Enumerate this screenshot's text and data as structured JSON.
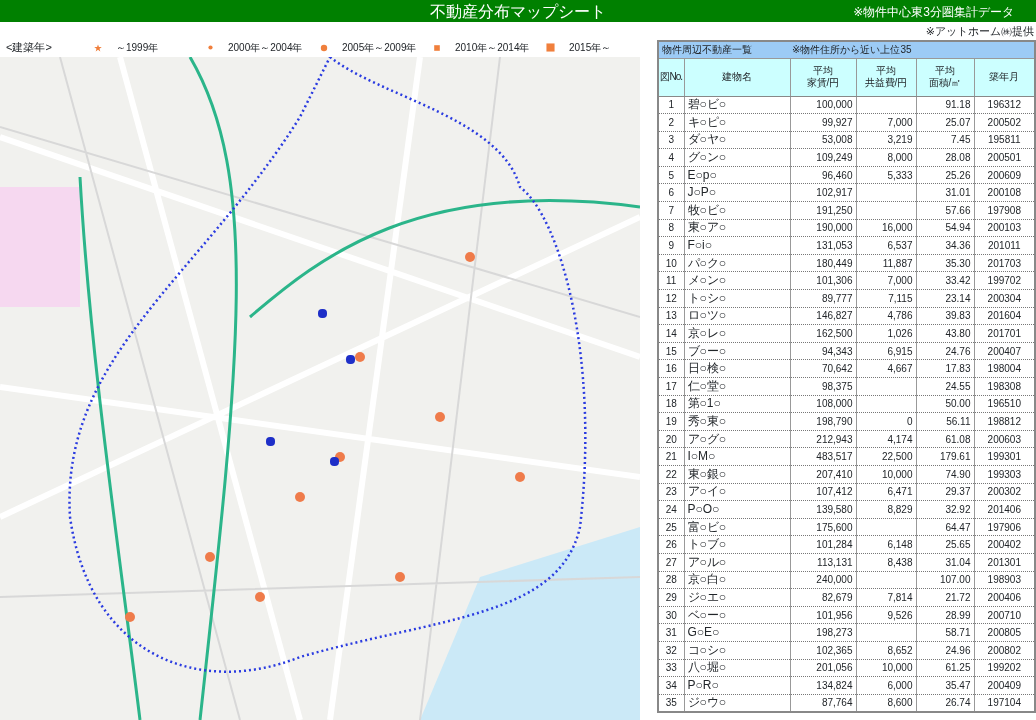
{
  "header": {
    "title": "不動産分布マップシート",
    "note": "※物件中心東3分圏集計データ",
    "credit": "※アットホーム㈱提供"
  },
  "legend": {
    "title": "<建築年>",
    "items": [
      {
        "kind": "star",
        "label": "～1999年"
      },
      {
        "kind": "small-dot",
        "label": "2000年～2004年"
      },
      {
        "kind": "dot",
        "label": "2005年～2009年"
      },
      {
        "kind": "small-square",
        "label": "2010年～2014年"
      },
      {
        "kind": "square",
        "label": "2015年～"
      }
    ]
  },
  "table": {
    "title": "物件周辺不動産一覧",
    "note": "※物件住所から近い上位35",
    "columns": [
      "図No.",
      "建物名",
      "平均家賃/円",
      "平均共益費/円",
      "平均面積/㎡",
      "築年月"
    ],
    "rows": [
      [
        "1",
        "碧○ビ○",
        "100,000",
        null,
        "91.18",
        "196312"
      ],
      [
        "2",
        "キ○ピ○",
        "99,927",
        "7,000",
        "25.07",
        "200502"
      ],
      [
        "3",
        "ダ○ヤ○",
        "53,008",
        "3,219",
        "7.45",
        "195811"
      ],
      [
        "4",
        "グ○ン○",
        "109,249",
        "8,000",
        "28.08",
        "200501"
      ],
      [
        "5",
        "E○p○",
        "96,460",
        "5,333",
        "25.26",
        "200609"
      ],
      [
        "6",
        "J○P○",
        "102,917",
        null,
        "31.01",
        "200108"
      ],
      [
        "7",
        "牧○ビ○",
        "191,250",
        null,
        "57.66",
        "197908"
      ],
      [
        "8",
        "東○ア○",
        "190,000",
        "16,000",
        "54.94",
        "200103"
      ],
      [
        "9",
        "F○i○",
        "131,053",
        "6,537",
        "34.36",
        "201011"
      ],
      [
        "10",
        "パ○ク○",
        "180,449",
        "11,887",
        "35.30",
        "201703"
      ],
      [
        "11",
        "メ○ン○",
        "101,306",
        "7,000",
        "33.42",
        "199702"
      ],
      [
        "12",
        "ト○シ○",
        "89,777",
        "7,115",
        "23.14",
        "200304"
      ],
      [
        "13",
        "ロ○ツ○",
        "146,827",
        "4,786",
        "39.83",
        "201604"
      ],
      [
        "14",
        "京○レ○",
        "162,500",
        "1,026",
        "43.80",
        "201701"
      ],
      [
        "15",
        "ブ○ー○",
        "94,343",
        "6,915",
        "24.76",
        "200407"
      ],
      [
        "16",
        "日○検○",
        "70,642",
        "4,667",
        "17.83",
        "198004"
      ],
      [
        "17",
        "仁○堂○",
        "98,375",
        null,
        "24.55",
        "198308"
      ],
      [
        "18",
        "第○1○",
        "108,000",
        null,
        "50.00",
        "196510"
      ],
      [
        "19",
        "秀○東○",
        "198,790",
        "0",
        "56.11",
        "198812"
      ],
      [
        "20",
        "ア○グ○",
        "212,943",
        "4,174",
        "61.08",
        "200603"
      ],
      [
        "21",
        "I○M○",
        "483,517",
        "22,500",
        "179.61",
        "199301"
      ],
      [
        "22",
        "東○銀○",
        "207,410",
        "10,000",
        "74.90",
        "199303"
      ],
      [
        "23",
        "ア○イ○",
        "107,412",
        "6,471",
        "29.37",
        "200302"
      ],
      [
        "24",
        "P○O○",
        "139,580",
        "8,829",
        "32.92",
        "201406"
      ],
      [
        "25",
        "富○ビ○",
        "175,600",
        null,
        "64.47",
        "197906"
      ],
      [
        "26",
        "ト○ブ○",
        "101,284",
        "6,148",
        "25.65",
        "200402"
      ],
      [
        "27",
        "ア○ル○",
        "113,131",
        "8,438",
        "31.04",
        "201301"
      ],
      [
        "28",
        "京○白○",
        "240,000",
        null,
        "107.00",
        "198903"
      ],
      [
        "29",
        "ジ○エ○",
        "82,679",
        "7,814",
        "21.72",
        "200406"
      ],
      [
        "30",
        "ベ○ー○",
        "101,956",
        "9,526",
        "28.99",
        "200710"
      ],
      [
        "31",
        "G○E○",
        "198,273",
        null,
        "58.71",
        "200805"
      ],
      [
        "32",
        "コ○シ○",
        "102,365",
        "8,652",
        "24.96",
        "200802"
      ],
      [
        "33",
        "八○堀○",
        "201,056",
        "10,000",
        "61.25",
        "199202"
      ],
      [
        "34",
        "P○R○",
        "134,824",
        "6,000",
        "35.47",
        "200409"
      ],
      [
        "35",
        "ジ○ウ○",
        "87,764",
        "8,600",
        "26.74",
        "197104"
      ]
    ]
  }
}
